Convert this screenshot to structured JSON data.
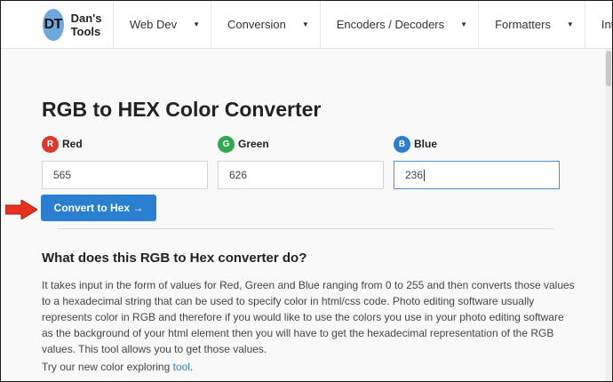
{
  "brand": {
    "logo_text": "DT",
    "name": "Dan's Tools",
    "logo_color": "#6fa8dc"
  },
  "nav": [
    {
      "label": "Web Dev",
      "caret": "▼"
    },
    {
      "label": "Conversion",
      "caret": "▼"
    },
    {
      "label": "Encoders / Decoders",
      "caret": "▼"
    },
    {
      "label": "Formatters",
      "caret": "▼"
    },
    {
      "label": "Internet",
      "caret": "▼"
    }
  ],
  "page": {
    "title": "RGB to HEX Color Converter",
    "fields": [
      {
        "badge": "R",
        "label": "Red",
        "value": "565",
        "badge_color": "#d93a2b"
      },
      {
        "badge": "G",
        "label": "Green",
        "value": "626",
        "badge_color": "#2fa84f"
      },
      {
        "badge": "B",
        "label": "Blue",
        "value": "236",
        "badge_color": "#2a7fd0"
      }
    ],
    "convert_button": "Convert to Hex →",
    "section_heading": "What does this RGB to Hex converter do?",
    "description": "It takes input in the form of values for Red, Green and Blue ranging from 0 to 255 and then converts those values to a hexadecimal string that can be used to specify color in html/css code. Photo editing software usually represents color in RGB and therefore if you would like to use the colors you use in your photo editing software as the background of your html element then you will have to get the hexadecimal representation of the RGB values. This tool allows you to get those values.",
    "try_prefix": "Try our new color exploring ",
    "try_link": "tool",
    "try_suffix": "."
  },
  "colors": {
    "accent": "#2a7fd0",
    "arrow": "#e8321e"
  },
  "icons": {
    "annotation_arrow": "red-arrow-icon"
  }
}
